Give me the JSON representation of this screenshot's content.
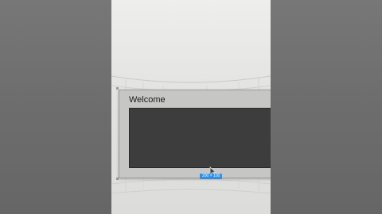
{
  "window": {
    "title": "Welcome"
  },
  "size_badge": {
    "text": "200 × 100"
  },
  "colors": {
    "accent": "#2f8ee6",
    "canvas": "#3d3d3d",
    "window_frame": "#c6c6c4",
    "backdrop": "#6f6f6f"
  },
  "cursor": {
    "icon": "arrow-cursor-icon"
  }
}
